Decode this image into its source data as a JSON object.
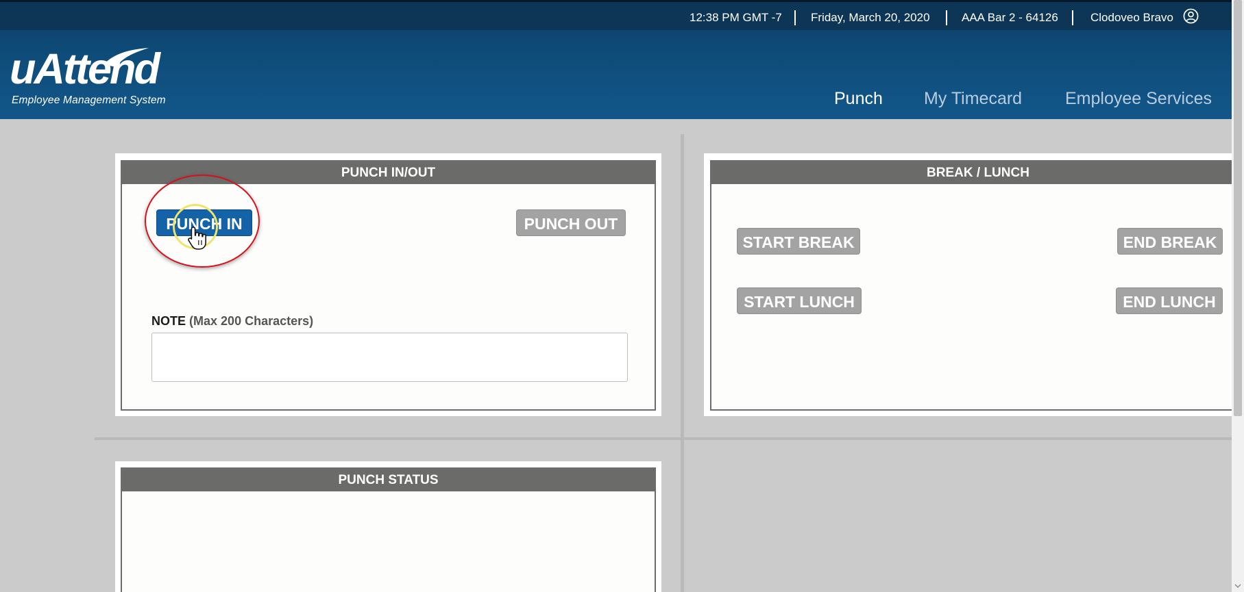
{
  "topbar": {
    "time": "12:38 PM GMT -7",
    "date": "Friday, March 20, 2020",
    "location": "AAA Bar 2 - 64126",
    "user_name": "Clodoveo Bravo",
    "user_icon": "user-circle-icon"
  },
  "logo": {
    "name": "uAttend",
    "tagline": "Employee Management System"
  },
  "nav": {
    "punch": "Punch",
    "timecard": "My Timecard",
    "services": "Employee Services",
    "active": "Punch"
  },
  "punch_panel": {
    "title": "PUNCH IN/OUT",
    "punch_in": "PUNCH IN",
    "punch_out": "PUNCH OUT",
    "note_label": "NOTE",
    "note_hint": "(Max 200 Characters)",
    "note_value": ""
  },
  "break_panel": {
    "title": "BREAK / LUNCH",
    "start_break": "START BREAK",
    "end_break": "END BREAK",
    "start_lunch": "START LUNCH",
    "end_lunch": "END LUNCH"
  },
  "status_panel": {
    "title": "PUNCH STATUS"
  },
  "colors": {
    "header": "#0e4a77",
    "primary_button": "#1463a8",
    "disabled_button": "#a3a3a3",
    "panel_header": "#6b6b69",
    "highlight_ring": "#d8101c",
    "click_ring": "#f0e36a"
  }
}
